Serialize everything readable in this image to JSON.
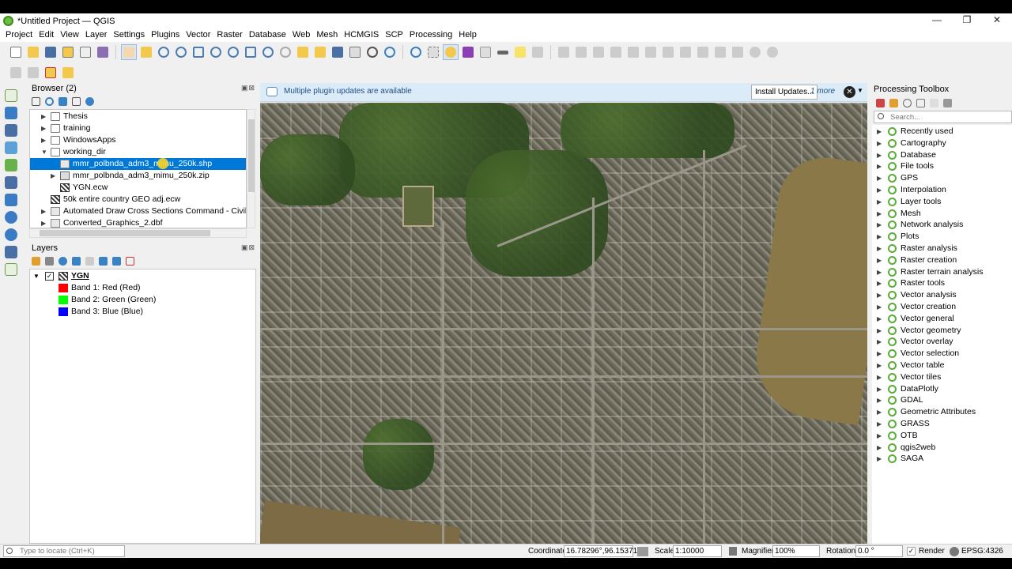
{
  "window": {
    "title": "*Untitled Project — QGIS",
    "controls": [
      "—",
      "❐",
      "✕"
    ]
  },
  "menu": [
    "Project",
    "Edit",
    "View",
    "Layer",
    "Settings",
    "Plugins",
    "Vector",
    "Raster",
    "Database",
    "Web",
    "Mesh",
    "HCMGIS",
    "SCP",
    "Processing",
    "Help"
  ],
  "browser": {
    "title": "Browser (2)",
    "items": [
      {
        "label": "Thesis",
        "type": "folder",
        "expand": "▶"
      },
      {
        "label": "training",
        "type": "folder",
        "expand": "▶"
      },
      {
        "label": "WindowsApps",
        "type": "folder",
        "expand": "▶"
      },
      {
        "label": "working_dir",
        "type": "folder",
        "expand": "▼"
      },
      {
        "label": "mmr_polbnda_adm3_mimu_250k.shp",
        "type": "vector",
        "expand": ""
      },
      {
        "label": "mmr_polbnda_adm3_mimu_250k.zip",
        "type": "zip",
        "expand": "▶"
      },
      {
        "label": "YGN.ecw",
        "type": "raster",
        "expand": ""
      },
      {
        "label": "50k entire country GEO adj.ecw",
        "type": "raster",
        "expand": ""
      },
      {
        "label": "Automated Draw Cross Sections Command - CivilGEO",
        "type": "vector",
        "expand": "▶"
      },
      {
        "label": "Converted_Graphics_2.dbf",
        "type": "vector",
        "expand": "▶"
      }
    ]
  },
  "layers": {
    "title": "Layers",
    "layer_name": "YGN",
    "checked": "✓",
    "bands": [
      {
        "label": "Band 1: Red (Red)",
        "color": "#ff0000"
      },
      {
        "label": "Band 2: Green (Green)",
        "color": "#00ff00"
      },
      {
        "label": "Band 3: Blue (Blue)",
        "color": "#0000ff"
      }
    ]
  },
  "messagebar": {
    "message": "Multiple plugin updates are available",
    "install_button": "Install Updates...",
    "more": "1 more"
  },
  "toolbox": {
    "title": "Processing Toolbox",
    "search_placeholder": "Search...",
    "items": [
      "Recently used",
      "Cartography",
      "Database",
      "File tools",
      "GPS",
      "Interpolation",
      "Layer tools",
      "Mesh",
      "Network analysis",
      "Plots",
      "Raster analysis",
      "Raster creation",
      "Raster terrain analysis",
      "Raster tools",
      "Vector analysis",
      "Vector creation",
      "Vector general",
      "Vector geometry",
      "Vector overlay",
      "Vector selection",
      "Vector table",
      "Vector tiles",
      "DataPlotly",
      "GDAL",
      "Geometric Attributes",
      "GRASS",
      "OTB",
      "qgis2web",
      "SAGA"
    ]
  },
  "statusbar": {
    "locate_placeholder": "Type to locate (Ctrl+K)",
    "coordinate_label": "Coordinate",
    "coordinate_value": "16.78296°,96.15371°",
    "scale_label": "Scale",
    "scale_value": "1:10000",
    "magnifier_label": "Magnifier",
    "magnifier_value": "100%",
    "rotation_label": "Rotation",
    "rotation_value": "0.0 °",
    "render_label": "Render",
    "crs": "EPSG:4326"
  },
  "colors": {
    "selection": "#0078d7",
    "qgis_green": "#5bab3a",
    "messagebar_bg": "#dcebf8"
  }
}
